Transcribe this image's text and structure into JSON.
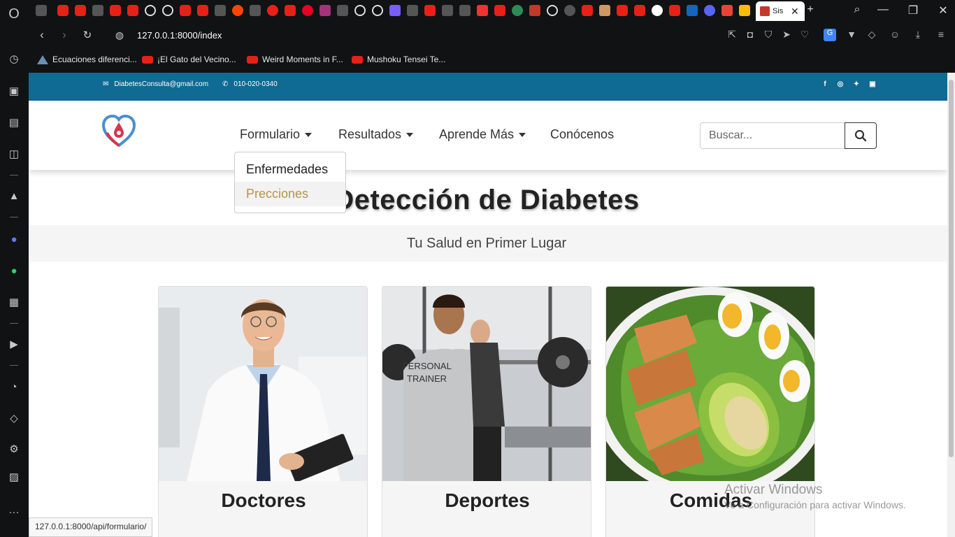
{
  "browser": {
    "active_tab_title": "Sis",
    "url": "127.0.0.1:8000/index",
    "status_url": "127.0.0.1:8000/api/formulario/",
    "bookmarks": [
      {
        "label": "Ecuaciones diferenci...",
        "icon": "folder-icon"
      },
      {
        "label": "¡El Gato del Vecino...",
        "icon": "youtube-icon"
      },
      {
        "label": "Weird Moments in F...",
        "icon": "youtube-icon"
      },
      {
        "label": "Mushoku Tensei Te...",
        "icon": "youtube-icon"
      }
    ]
  },
  "site": {
    "email": "DiabetesConsulta@gmail.com",
    "phone": "010-020-0340",
    "social": [
      "f",
      "ig",
      "tw",
      "in"
    ],
    "nav": [
      {
        "label": "Formulario",
        "dropdown": true
      },
      {
        "label": "Resultados",
        "dropdown": true
      },
      {
        "label": "Aprende Más",
        "dropdown": true
      },
      {
        "label": "Conócenos",
        "dropdown": false
      }
    ],
    "dropdown_items": [
      "Enfermedades",
      "Precciones"
    ],
    "search_placeholder": "Buscar...",
    "hero_title": "Detección de Diabetes",
    "hero_subtitle": "Tu Salud en Primer Lugar",
    "cards": [
      {
        "title": "Doctores"
      },
      {
        "title": "Deportes"
      },
      {
        "title": "Comidas"
      }
    ]
  },
  "watermark": {
    "line1": "Activar Windows",
    "line2": "Ve a Configuración para activar Windows."
  },
  "colors": {
    "topbar": "#0f6a94",
    "dropdown_active": "#b8934a"
  }
}
